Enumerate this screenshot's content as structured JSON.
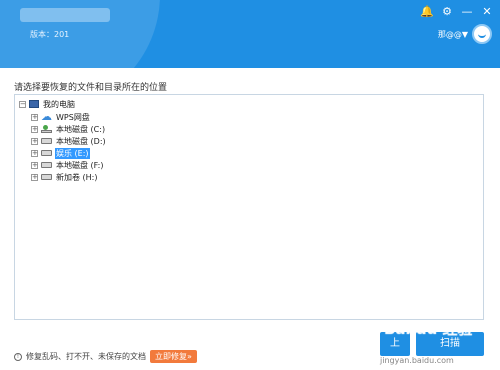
{
  "header": {
    "app_title": "",
    "version": "版本：201",
    "user_name": "那@@▼",
    "icons": [
      "bell-icon",
      "gear-icon",
      "minimize-icon",
      "close-icon"
    ],
    "minimize_symbol": "—",
    "close_symbol": "✕",
    "bell_symbol": "🔔",
    "gear_symbol": "⚙"
  },
  "main": {
    "prompt": "请选择要恢复的文件和目录所在的位置",
    "tree": {
      "root": {
        "expander": "−",
        "label": "我的电脑"
      },
      "items": [
        {
          "expander": "+",
          "label": "WPS网盘",
          "icon": "cloud-icon"
        },
        {
          "expander": "+",
          "label": "本地磁盘 (C:)",
          "icon": "system-drive-icon"
        },
        {
          "expander": "+",
          "label": "本地磁盘 (D:)",
          "icon": "drive-icon"
        },
        {
          "expander": "+",
          "label": "娱乐 (E:)",
          "icon": "drive-icon",
          "selected": true
        },
        {
          "expander": "+",
          "label": "本地磁盘 (F:)",
          "icon": "drive-icon"
        },
        {
          "expander": "+",
          "label": "新加卷 (H:)",
          "icon": "drive-icon"
        }
      ]
    }
  },
  "footer": {
    "note": "修复乱码、打不开、未保存的文档",
    "fix_now": "立即修复»",
    "back_button": "上",
    "scan_button": "扫描",
    "watermark": "Bai du 经验",
    "watermark_url": "jingyan.baidu.com"
  },
  "colors": {
    "accent": "#1f8fe3",
    "selected": "#3399ff",
    "fix_button": "#f27a3c"
  }
}
